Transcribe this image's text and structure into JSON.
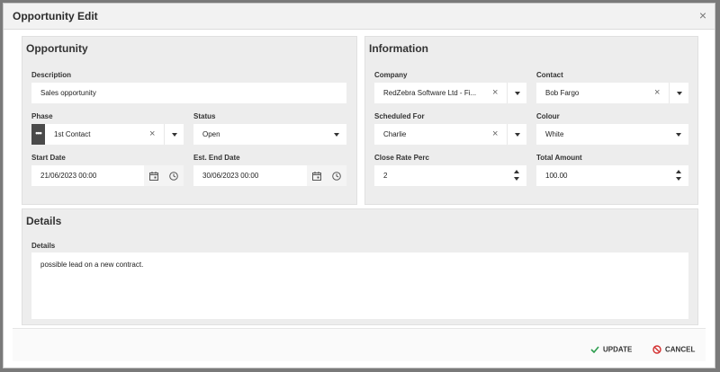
{
  "dialog": {
    "title": "Opportunity Edit",
    "close_glyph": "×"
  },
  "opportunity": {
    "title": "Opportunity",
    "description": {
      "label": "Description",
      "value": "Sales opportunity"
    },
    "phase": {
      "label": "Phase",
      "value": "1st Contact",
      "more_glyph": "•••"
    },
    "status": {
      "label": "Status",
      "value": "Open"
    },
    "start_date": {
      "label": "Start Date",
      "value": "21/06/2023 00:00"
    },
    "end_date": {
      "label": "Est. End Date",
      "value": "30/06/2023 00:00"
    }
  },
  "information": {
    "title": "Information",
    "company": {
      "label": "Company",
      "value": "RedZebra Software Ltd - Fi..."
    },
    "contact": {
      "label": "Contact",
      "value": "Bob Fargo"
    },
    "scheduled_for": {
      "label": "Scheduled For",
      "value": "Charlie"
    },
    "colour": {
      "label": "Colour",
      "value": "White"
    },
    "close_rate": {
      "label": "Close Rate Perc",
      "value": "2"
    },
    "total_amount": {
      "label": "Total Amount",
      "value": "100.00"
    }
  },
  "details": {
    "title": "Details",
    "label": "Details",
    "value": "possible lead on a new contract."
  },
  "footer": {
    "update_label": "UPDATE",
    "cancel_label": "CANCEL"
  },
  "icons": {
    "clear": "close-icon",
    "dropdown": "chevron-down-icon",
    "calendar": "calendar-icon",
    "clock": "clock-icon",
    "update": "check-icon",
    "cancel": "cancel-icon"
  },
  "colors": {
    "accent_check": "#2e9e4f",
    "cancel_red": "#d32f2f",
    "panel_bg": "#ededed"
  }
}
